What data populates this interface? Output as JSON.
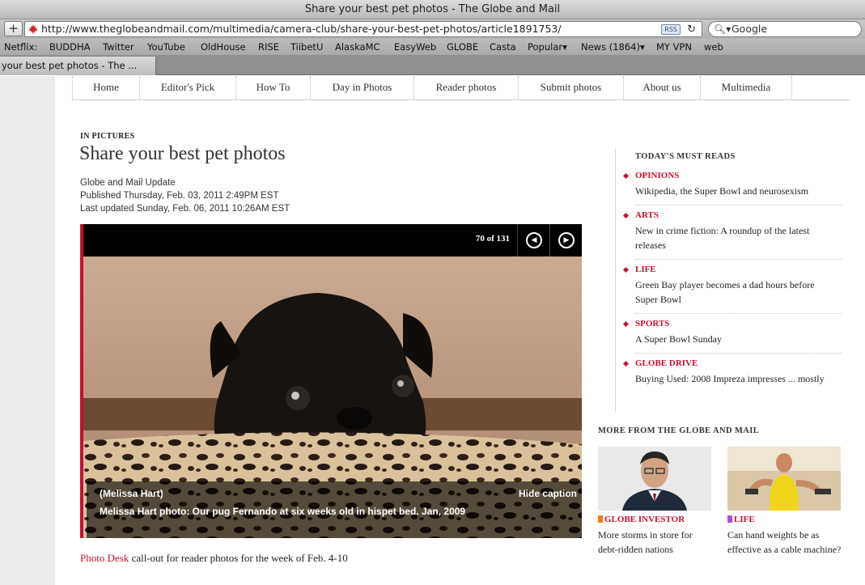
{
  "browser": {
    "window_title": "Share your best pet photos - The Globe and Mail",
    "add_button": "+",
    "url": "http://www.theglobeandmail.com/multimedia/camera-club/share-your-best-pet-photos/article1891753/",
    "rss_label": "RSS",
    "search_placeholder": "Google",
    "bookmarks": [
      "Netflix:",
      "BUDDHA",
      "Twitter",
      "YouTube",
      "OldHouse",
      "RISE",
      "TiibetU",
      "AlaskaMC",
      "EasyWeb",
      "GLOBE",
      "Casta",
      "Popular▾",
      "News (1864)▾",
      "MY VPN",
      "web"
    ],
    "tab_title": "your best pet photos - The ..."
  },
  "nav": {
    "items": [
      "Home",
      "Editor's Pick",
      "How To",
      "Day in Photos",
      "Reader photos",
      "Submit photos",
      "About us",
      "Multimedia"
    ]
  },
  "article": {
    "kicker": "IN PICTURES",
    "headline": "Share your best pet photos",
    "source": "Globe and Mail Update",
    "published": "Published Thursday, Feb. 03, 2011 2:49PM EST",
    "updated": "Last updated Sunday, Feb. 06, 2011 10:26AM EST"
  },
  "gallery": {
    "counter": "70 of 131",
    "credit": "(Melissa Hart)",
    "hide_caption": "Hide caption",
    "caption": "Melissa Hart photo: Our pug Fernando at six weeks old in hispet bed. Jan, 2009"
  },
  "callout": {
    "link": "Photo Desk",
    "text": " call-out for reader photos for the week of Feb. 4-10"
  },
  "must_reads": {
    "title": "TODAY'S MUST READS",
    "items": [
      {
        "category": "OPINIONS",
        "text": "Wikipedia, the Super Bowl and neurosexism"
      },
      {
        "category": "ARTS",
        "text": "New in crime fiction: A roundup of the latest releases"
      },
      {
        "category": "LIFE",
        "text": "Green Bay player becomes a dad hours before Super Bowl"
      },
      {
        "category": "SPORTS",
        "text": "A Super Bowl Sunday"
      },
      {
        "category": "GLOBE DRIVE",
        "text": "Buying Used: 2008 Impreza impresses ... mostly"
      }
    ]
  },
  "more": {
    "title": "MORE FROM THE GLOBE AND MAIL",
    "items": [
      {
        "category": "GLOBE INVESTOR",
        "text": "More storms in store for debt-ridden nations",
        "color": "#f07a1a"
      },
      {
        "category": "LIFE",
        "text": "Can hand weights be as effective as a cable machine?",
        "color": "#b54ccf"
      }
    ]
  },
  "colors": {
    "accent": "#c8102e"
  }
}
